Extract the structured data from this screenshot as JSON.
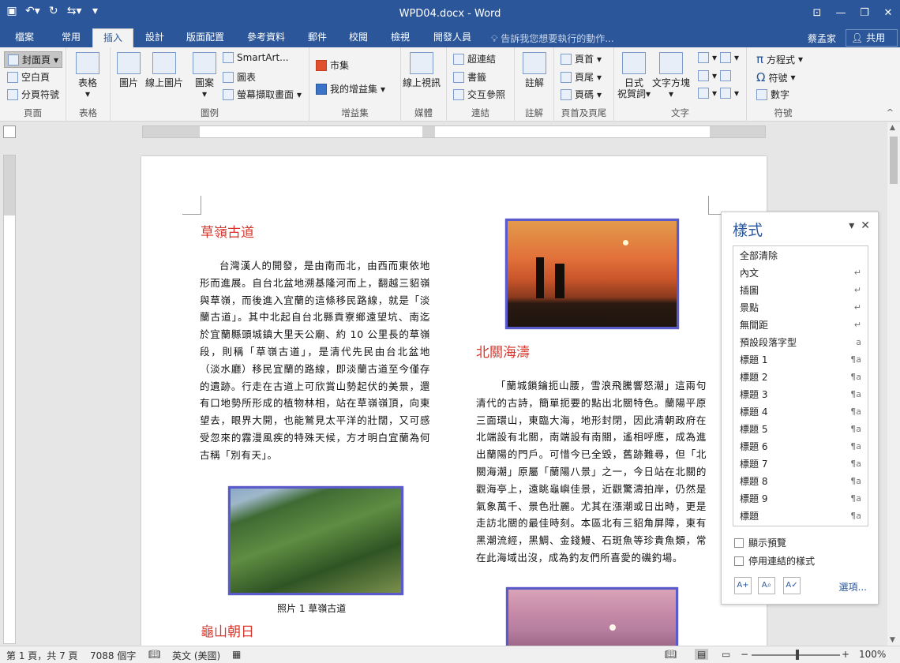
{
  "window": {
    "title": "WPD04.docx - Word",
    "qat_icons": [
      "save-icon",
      "undo-icon",
      "redo-icon",
      "touch-mode-icon",
      "customize-icon"
    ]
  },
  "tabs": [
    "檔案",
    "常用",
    "插入",
    "設計",
    "版面配置",
    "參考資料",
    "郵件",
    "校閱",
    "檢視",
    "開發人員"
  ],
  "active_tab": "插入",
  "tell_me": "告訴我您想要執行的動作...",
  "user": "蔡孟家",
  "share": "共用",
  "ribbon": {
    "pages": {
      "label": "頁面",
      "cover": "封面頁",
      "blank": "空白頁",
      "page_break": "分頁符號"
    },
    "tables": {
      "label": "表格",
      "table": "表格"
    },
    "illustrations": {
      "label": "圖例",
      "pictures": "圖片",
      "online_pictures": "線上圖片",
      "shapes": "圖案",
      "smartart": "SmartArt...",
      "chart": "圖表",
      "screenshot": "螢幕擷取畫面"
    },
    "addins": {
      "label": "增益集",
      "store": "市集",
      "my_addins": "我的增益集"
    },
    "media": {
      "label": "媒體",
      "online_video": "線上視訊"
    },
    "links": {
      "label": "連結",
      "hyperlink": "超連結",
      "bookmark": "書籤",
      "cross_ref": "交互參照"
    },
    "comments": {
      "label": "註解",
      "comment": "註解"
    },
    "header_footer": {
      "label": "頁首及頁尾",
      "header": "頁首",
      "footer": "頁尾",
      "page_number": "頁碼"
    },
    "text": {
      "label": "文字",
      "date_greeting_1": "日式",
      "date_greeting_2": "祝賀詞",
      "textbox": "文字方塊"
    },
    "symbols": {
      "label": "符號",
      "equation": "方程式",
      "symbol": "符號",
      "number": "數字"
    }
  },
  "document": {
    "h1": "草嶺古道",
    "p1": "台灣漢人的開發，是由南而北，由西而東依地形而進展。自台北盆地溯基隆河而上，翻越三貂嶺與草嶺，而後進入宜蘭的這條移民路線，就是「淡蘭古道」。其中北起自台北縣貢寮鄉遠望坑、南迄於宜蘭縣頭城鎮大里天公廟、約 10 公里長的草嶺段，則稱「草嶺古道」，是清代先民由台北盆地（淡水廳）移民宜蘭的路線，即淡蘭古道至今僅存的遺跡。行走在古道上可欣賞山勢起伏的美景，還有口地勢所形成的植物林相，站在草嶺嶺頂，向東望去，眼界大開，也能鷲見太平洋的壯闊，又可感受忽來的霧漫風疾的特殊天候，方才明白宜蘭為何古稱「別有天」。",
    "caption": "照片 1 草嶺古道",
    "h2": "龜山朝日",
    "h3": "北關海濤",
    "p2": "「蘭城鎖鑰扼山腰，雪浪飛騰響怒潮」這兩句清代的古詩，簡單扼要的點出北關特色。蘭陽平原三面環山，東臨大海，地形封閉，因此清朝政府在北端設有北關，南端設有南關，遙相呼應，成為進出蘭陽的門戶。可惜今已全毀，舊跡難尋，但「北關海潮」原屬「蘭陽八景」之一，今日站在北關的觀海亭上，遠眺龜嶼佳景，近觀驚濤拍岸，仍然是氣象萬千、景色壯麗。尤其在漲潮或日出時，更是走訪北關的最佳時刻。本區北有三貂角屏障，東有黑潮流經，黑鯛、金錢鰻、石斑魚等珍貴魚類，常在此海域出沒，成為釣友們所喜愛的磯釣場。"
  },
  "styles_pane": {
    "title": "樣式",
    "items": [
      {
        "name": "全部清除",
        "mark": ""
      },
      {
        "name": "內文",
        "mark": "↵"
      },
      {
        "name": "插圖",
        "mark": "↵"
      },
      {
        "name": "景點",
        "mark": "↵"
      },
      {
        "name": "無間距",
        "mark": "↵"
      },
      {
        "name": "預設段落字型",
        "mark": "a"
      },
      {
        "name": "標題 1",
        "mark": "¶a"
      },
      {
        "name": "標題 2",
        "mark": "¶a"
      },
      {
        "name": "標題 3",
        "mark": "¶a"
      },
      {
        "name": "標題 4",
        "mark": "¶a"
      },
      {
        "name": "標題 5",
        "mark": "¶a"
      },
      {
        "name": "標題 6",
        "mark": "¶a"
      },
      {
        "name": "標題 7",
        "mark": "¶a"
      },
      {
        "name": "標題 8",
        "mark": "¶a"
      },
      {
        "name": "標題 9",
        "mark": "¶a"
      },
      {
        "name": "標題",
        "mark": "¶a"
      }
    ],
    "show_preview": "顯示預覽",
    "disable_linked": "停用連結的樣式",
    "options": "選項..."
  },
  "status": {
    "page": "第 1 頁，共 7 頁",
    "words": "7088 個字",
    "lang": "英文 (美國)",
    "zoom": "100%"
  },
  "colors": {
    "accent": "#2b579a",
    "heading": "#d6362b"
  }
}
